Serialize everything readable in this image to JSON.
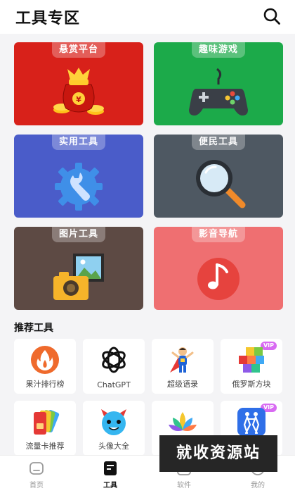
{
  "header": {
    "title": "工具专区",
    "search_icon": "search-icon"
  },
  "categories": [
    {
      "label": "悬赏平台",
      "icon": "money-bag-icon",
      "color": "#d8211a"
    },
    {
      "label": "趣味游戏",
      "icon": "gamepad-icon",
      "color": "#1caa4a"
    },
    {
      "label": "实用工具",
      "icon": "wrench-gear-icon",
      "color": "#4a5cc9"
    },
    {
      "label": "便民工具",
      "icon": "magnifier-icon",
      "color": "#4e5862"
    },
    {
      "label": "图片工具",
      "icon": "camera-photo-icon",
      "color": "#5d4a44"
    },
    {
      "label": "影音导航",
      "icon": "music-note-icon",
      "color": "#ef6f71"
    }
  ],
  "recommended": {
    "title": "推荐工具",
    "items": [
      {
        "label": "果汁排行榜",
        "icon": "flame-icon"
      },
      {
        "label": "ChatGPT",
        "icon": "openai-knot-icon"
      },
      {
        "label": "超级语录",
        "icon": "superhero-icon"
      },
      {
        "label": "俄罗斯方块",
        "icon": "blocks-icon",
        "badge": "VIP"
      },
      {
        "label": "流量卡推荐",
        "icon": "sim-cards-icon"
      },
      {
        "label": "头像大全",
        "icon": "cute-monster-icon"
      },
      {
        "label": "",
        "icon": "lotus-icon"
      },
      {
        "label": "",
        "icon": "dance-couple-icon",
        "badge": "VIP"
      }
    ]
  },
  "nav": {
    "items": [
      {
        "label": "首页",
        "icon": "home-icon"
      },
      {
        "label": "工具",
        "icon": "tools-doc-icon",
        "active": true
      },
      {
        "label": "软件",
        "icon": "apps-icon"
      },
      {
        "label": "我的",
        "icon": "profile-icon"
      }
    ]
  },
  "watermark": "就收资源站"
}
